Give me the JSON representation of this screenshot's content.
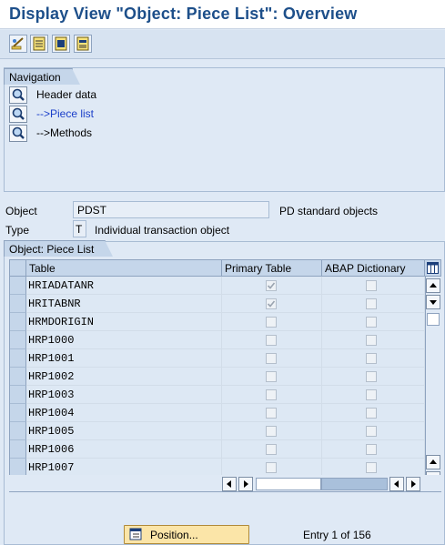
{
  "title": "Display View \"Object: Piece List\": Overview",
  "toolbar": {
    "buttons": [
      "display-change-icon",
      "details-icon",
      "select-all-icon",
      "select-block-icon"
    ]
  },
  "navigation": {
    "tab_label": "Navigation",
    "items": [
      {
        "label": "Header data",
        "active": false
      },
      {
        "label": "-->Piece list",
        "active": true
      },
      {
        "label": "-->Methods",
        "active": false
      }
    ]
  },
  "fields": {
    "object_label": "Object",
    "object_value": "PDST",
    "object_desc": "PD standard objects",
    "type_label": "Type",
    "type_value": "T",
    "type_desc": "Individual transaction object"
  },
  "table": {
    "tab_label": "Object: Piece List",
    "columns": [
      "Table",
      "Primary Table",
      "ABAP Dictionary"
    ],
    "rows": [
      {
        "name": "HRIADATANR",
        "primary": true,
        "abap": false
      },
      {
        "name": "HRITABNR",
        "primary": true,
        "abap": false
      },
      {
        "name": "HRMDORIGIN",
        "primary": false,
        "abap": false
      },
      {
        "name": "HRP1000",
        "primary": false,
        "abap": false
      },
      {
        "name": "HRP1001",
        "primary": false,
        "abap": false
      },
      {
        "name": "HRP1002",
        "primary": false,
        "abap": false
      },
      {
        "name": "HRP1003",
        "primary": false,
        "abap": false
      },
      {
        "name": "HRP1004",
        "primary": false,
        "abap": false
      },
      {
        "name": "HRP1005",
        "primary": false,
        "abap": false
      },
      {
        "name": "HRP1006",
        "primary": false,
        "abap": false
      },
      {
        "name": "HRP1007",
        "primary": false,
        "abap": false
      }
    ]
  },
  "footer": {
    "position_button": "Position...",
    "entry_text": "Entry 1 of 156"
  }
}
